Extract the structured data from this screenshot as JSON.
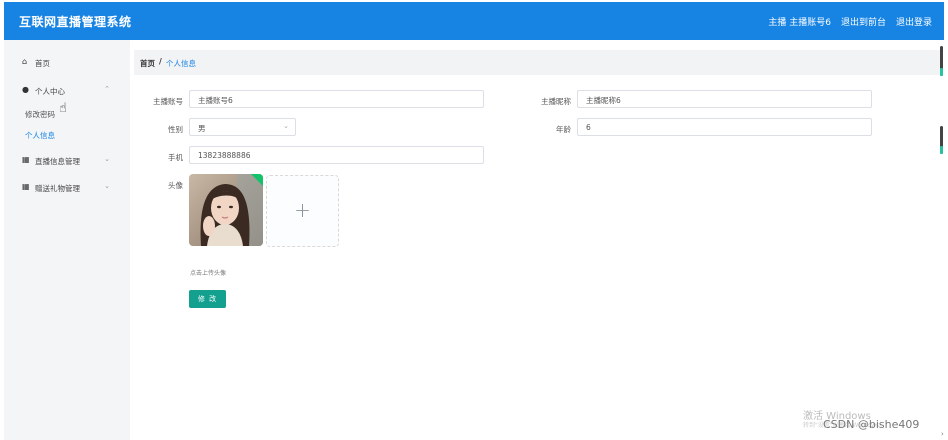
{
  "header": {
    "app_title": "互联网直播管理系统",
    "user_label": "主播 主播账号6",
    "back_to_admin": "退出到前台",
    "logout": "退出登录"
  },
  "sidebar": {
    "home": "首页",
    "personal_center": "个人中心",
    "change_password": "修改密码",
    "personal_info": "个人信息",
    "live_info_mgmt": "直播信息管理",
    "gift_mgmt": "赠送礼物管理"
  },
  "breadcrumb": {
    "home": "首页",
    "separator": "/",
    "current": "个人信息"
  },
  "form": {
    "account_label": "主播账号",
    "account_value": "主播账号6",
    "nickname_label": "主播昵称",
    "nickname_value": "主播昵称6",
    "gender_label": "性别",
    "gender_value": "男",
    "age_label": "年龄",
    "age_value": "6",
    "phone_label": "手机",
    "phone_value": "13823888886",
    "avatar_label": "头像",
    "upload_hint": "点击上传头像",
    "submit_label": "修 改"
  },
  "watermarks": {
    "windows_activate": "激活 Windows",
    "windows_sub": "转到\"设置\"以激活 Windows。",
    "csdn": "CSDN @bishe409"
  },
  "colors": {
    "primary": "#1784e4",
    "submit": "#13a08f"
  }
}
